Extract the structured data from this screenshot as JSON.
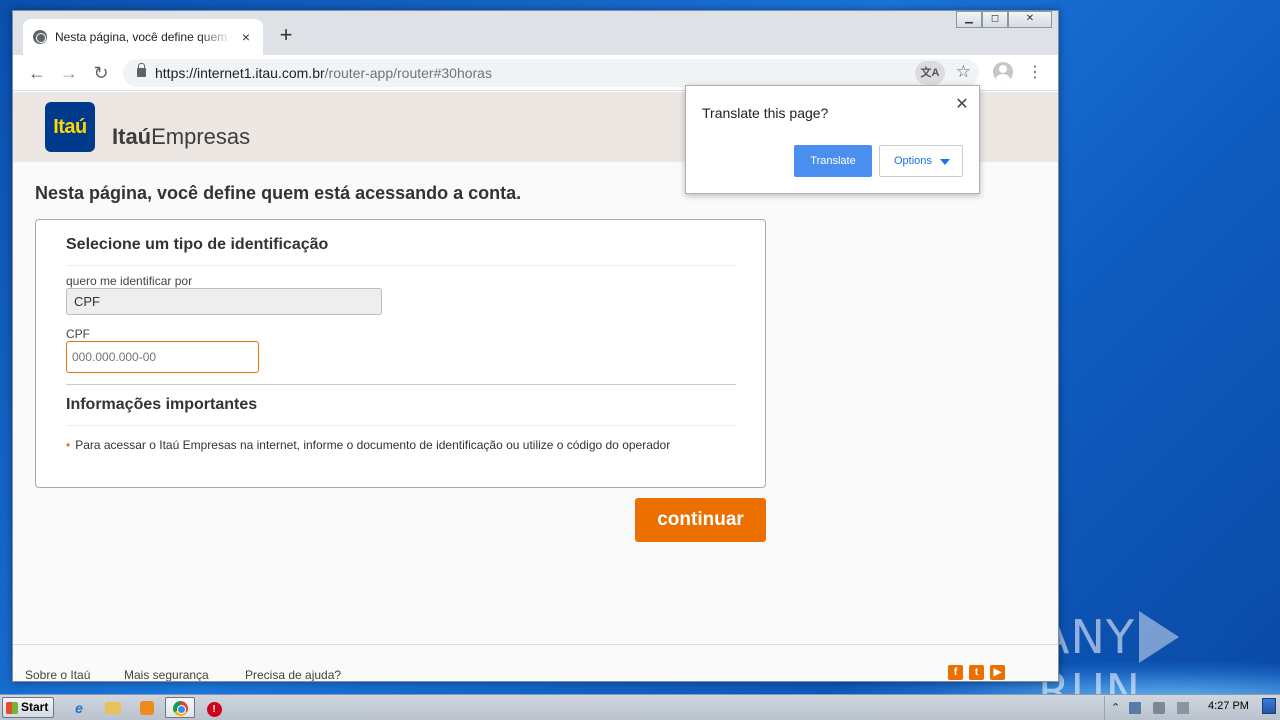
{
  "browser": {
    "tab_title": "Nesta página, você define quem está acessando a conta.",
    "tab_close": "×",
    "new_tab": "+",
    "url_host": "https://internet1.itau.com.br",
    "url_path": "/router-app/router#30horas",
    "translate_icon": "文A",
    "star": "☆",
    "menu": "⋮",
    "back": "←",
    "forward": "→",
    "reload": "↻",
    "window_controls": {
      "minimize": "▁",
      "maximize": "◻",
      "close": "✕"
    }
  },
  "translate_popup": {
    "question": "Translate this page?",
    "close": "✕",
    "translate_label": "Translate",
    "options_label": "Options"
  },
  "site": {
    "logo_text": "Itaú",
    "brand_bold": "Itaú",
    "brand_rest": "Empresas",
    "heading": "Nesta página, você define quem está acessando a conta."
  },
  "form": {
    "section_title": "Selecione um tipo de identificação",
    "identify_by_label": "quero me identificar por",
    "identify_by_value": "CPF",
    "cpf_label": "CPF",
    "cpf_placeholder": "000.000.000-00",
    "info_title": "Informações importantes",
    "info_text": "Para acessar o Itaú Empresas na internet, informe o documento de identificação ou utilize o código do operador",
    "bullet": "•",
    "continue_label": "continuar"
  },
  "footer": {
    "links": [
      "Sobre o Itaú",
      "Mais segurança",
      "Precisa de ajuda?"
    ],
    "social": [
      "f",
      "t",
      "▶"
    ]
  },
  "watermark": {
    "left": "ANY",
    "right": "RUN"
  },
  "taskbar": {
    "start_label": "Start",
    "ie_glyph": "e",
    "stop_glyph": "!",
    "tray_up": "⌃",
    "clock": "4:27 PM"
  },
  "colors": {
    "accent_orange": "#ec7000",
    "itau_blue": "#003a8c",
    "itau_yellow": "#fcd800",
    "translate_blue": "#4a8ff0"
  }
}
